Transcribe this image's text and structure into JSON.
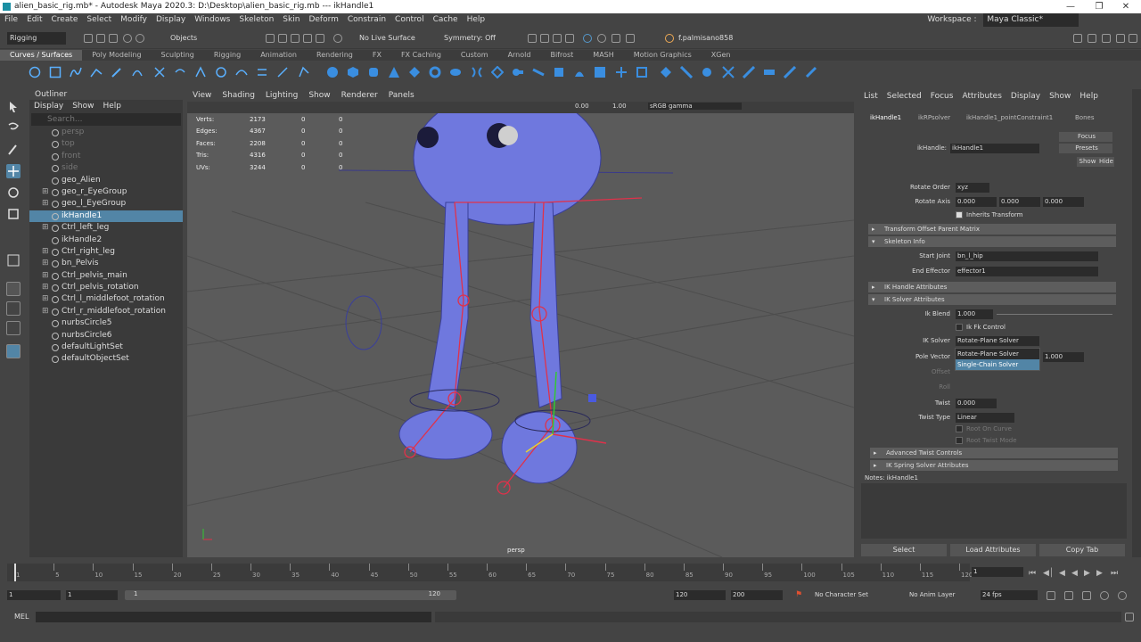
{
  "window": {
    "title": "alien_basic_rig.mb* - Autodesk Maya 2020.3: D:\\Desktop\\alien_basic_rig.mb  ---  ikHandle1"
  },
  "menubar": {
    "items": [
      "File",
      "Edit",
      "Create",
      "Select",
      "Modify",
      "Display",
      "Windows",
      "Skeleton",
      "Skin",
      "Deform",
      "Constrain",
      "Control",
      "Cache",
      "Help"
    ],
    "workspace_label": "Workspace :",
    "workspace_value": "Maya Classic*"
  },
  "statusline": {
    "menuset": "Rigging",
    "objects": "Objects",
    "live_surface": "No Live Surface",
    "symmetry": "Symmetry: Off",
    "user": "f.palmisano858"
  },
  "shelf": {
    "tabs": [
      "Curves / Surfaces",
      "Poly Modeling",
      "Sculpting",
      "Rigging",
      "Animation",
      "Rendering",
      "FX",
      "FX Caching",
      "Custom",
      "Arnold",
      "Bifrost",
      "MASH",
      "Motion Graphics",
      "XGen"
    ],
    "active_tab": "Curves / Surfaces"
  },
  "outliner": {
    "title": "Outliner",
    "menu": [
      "Display",
      "Show",
      "Help"
    ],
    "search_placeholder": "Search...",
    "items": [
      {
        "label": "persp",
        "dim": true
      },
      {
        "label": "top",
        "dim": true
      },
      {
        "label": "front",
        "dim": true
      },
      {
        "label": "side",
        "dim": true
      },
      {
        "label": "geo_Alien",
        "dim": false
      },
      {
        "label": "geo_r_EyeGroup",
        "dim": false
      },
      {
        "label": "geo_l_EyeGroup",
        "dim": false
      },
      {
        "label": "ikHandle1",
        "dim": false,
        "selected": true
      },
      {
        "label": "Ctrl_left_leg",
        "dim": false
      },
      {
        "label": "ikHandle2",
        "dim": false
      },
      {
        "label": "Ctrl_right_leg",
        "dim": false
      },
      {
        "label": "bn_Pelvis",
        "dim": false
      },
      {
        "label": "Ctrl_pelvis_main",
        "dim": false
      },
      {
        "label": "Ctrl_pelvis_rotation",
        "dim": false
      },
      {
        "label": "Ctrl_l_middlefoot_rotation",
        "dim": false
      },
      {
        "label": "Ctrl_r_middlefoot_rotation",
        "dim": false
      },
      {
        "label": "nurbsCircle5",
        "dim": false
      },
      {
        "label": "nurbsCircle6",
        "dim": false
      },
      {
        "label": "defaultLightSet",
        "dim": false
      },
      {
        "label": "defaultObjectSet",
        "dim": false
      }
    ]
  },
  "viewport": {
    "menu": [
      "View",
      "Shading",
      "Lighting",
      "Show",
      "Renderer",
      "Panels"
    ],
    "exposure": "0.00",
    "gamma": "1.00",
    "colorspace": "sRGB gamma",
    "hud": [
      {
        "label": "Verts:",
        "v1": "2173",
        "v2": "0",
        "v3": "0"
      },
      {
        "label": "Edges:",
        "v1": "4367",
        "v2": "0",
        "v3": "0"
      },
      {
        "label": "Faces:",
        "v1": "2208",
        "v2": "0",
        "v3": "0"
      },
      {
        "label": "Tris:",
        "v1": "4316",
        "v2": "0",
        "v3": "0"
      },
      {
        "label": "UVs:",
        "v1": "3244",
        "v2": "0",
        "v3": "0"
      }
    ],
    "camera": "persp"
  },
  "attr": {
    "menu": [
      "List",
      "Selected",
      "Focus",
      "Attributes",
      "Display",
      "Show",
      "Help"
    ],
    "tabs": [
      "ikHandle1",
      "ikRPsolver",
      "ikHandle1_pointConstraint1",
      "Bones"
    ],
    "node_label": "ikHandle:",
    "node_name": "ikHandle1",
    "focus": "Focus",
    "presets": "Presets",
    "show": "Show",
    "hide": "Hide",
    "rotate_order_label": "Rotate Order",
    "rotate_order": "xyz",
    "rotate_axis_label": "Rotate Axis",
    "rotate_axis": [
      "0.000",
      "0.000",
      "0.000"
    ],
    "inherits_transform": "Inherits Transform",
    "sec_transform_offset": "Transform Offset Parent Matrix",
    "sec_skeleton": "Skeleton Info",
    "start_joint_label": "Start Joint",
    "start_joint": "bn_l_hip",
    "end_effector_label": "End Effector",
    "end_effector": "effector1",
    "sec_ik_handle": "IK Handle Attributes",
    "sec_ik_solver": "IK Solver Attributes",
    "ik_blend_label": "Ik Blend",
    "ik_blend": "1.000",
    "ik_fk_control": "Ik Fk Control",
    "ik_solver_label": "IK Solver",
    "ik_solver": "Rotate-Plane Solver",
    "dropdown_options": [
      "Rotate-Plane Solver",
      "Single-Chain Solver"
    ],
    "pole_vector_label": "Pole Vector",
    "pole_vector_z": "1.000",
    "offset_label": "Offset",
    "roll_label": "Roll",
    "twist_label": "Twist",
    "twist": "0.000",
    "twist_type_label": "Twist Type",
    "twist_type": "Linear",
    "root_on_curve": "Root On Curve",
    "root_twist_mode": "Root Twist Mode",
    "sec_adv_twist": "Advanced Twist Controls",
    "sec_ik_spring": "IK Spring Solver Attributes",
    "notes": "Notes:  ikHandle1",
    "btn_select": "Select",
    "btn_load": "Load Attributes",
    "btn_copy": "Copy Tab"
  },
  "timeline": {
    "ticks": [
      "1",
      "5",
      "10",
      "15",
      "20",
      "25",
      "30",
      "35",
      "40",
      "45",
      "50",
      "55",
      "60",
      "65",
      "70",
      "75",
      "80",
      "85",
      "90",
      "95",
      "100",
      "105",
      "110",
      "115",
      "120"
    ],
    "current_frame": "1",
    "range_start": "1",
    "playback_start": "1",
    "playback_end": "120",
    "range_end": "120",
    "anim_end": "200",
    "character_set": "No Character Set",
    "anim_layer": "No Anim Layer",
    "fps": "24 fps"
  },
  "cmdline": {
    "lang": "MEL"
  },
  "colors": {
    "selected": "#5285a6",
    "mesh": "#6f78de",
    "joint": "#e0314a"
  }
}
